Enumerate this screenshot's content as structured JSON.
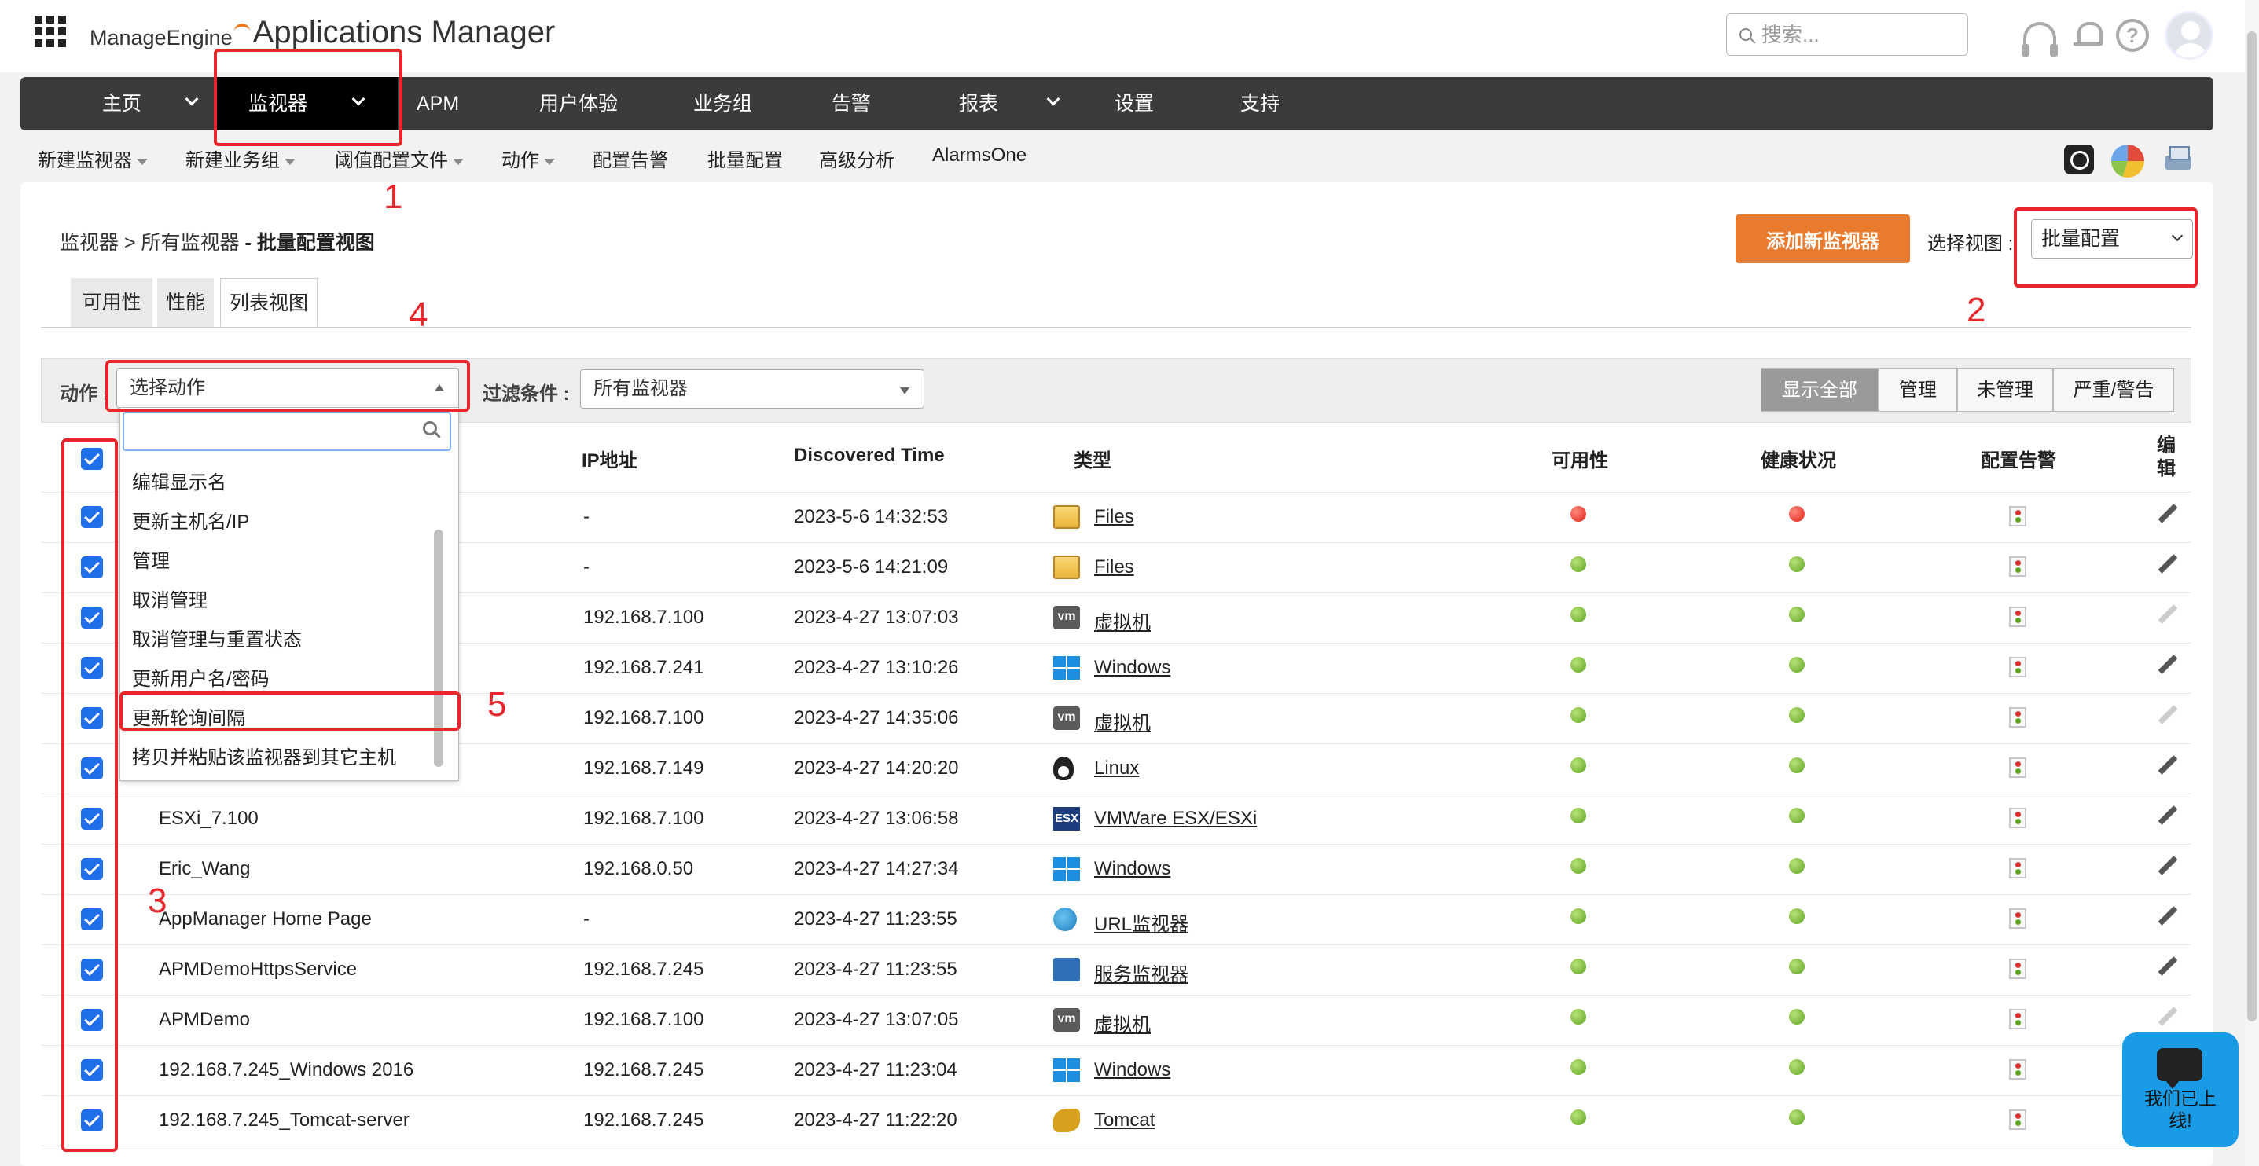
{
  "brand": {
    "prefix": "ManageEngine",
    "product": "Applications Manager"
  },
  "search": {
    "placeholder": "搜索..."
  },
  "main_nav": [
    {
      "label": "主页"
    },
    {
      "label": "监视器"
    },
    {
      "label": "APM"
    },
    {
      "label": "用户体验"
    },
    {
      "label": "业务组"
    },
    {
      "label": "告警"
    },
    {
      "label": "报表"
    },
    {
      "label": "设置"
    },
    {
      "label": "支持"
    }
  ],
  "sub_nav": [
    {
      "label": "新建监视器"
    },
    {
      "label": "新建业务组"
    },
    {
      "label": "阈值配置文件"
    },
    {
      "label": "动作"
    },
    {
      "label": "配置告警"
    },
    {
      "label": "批量配置"
    },
    {
      "label": "高级分析"
    },
    {
      "label": "AlarmsOne"
    }
  ],
  "breadcrumb": {
    "root": "监视器",
    "sep": " > ",
    "middle": "所有监视器",
    "current": " - 批量配置视图"
  },
  "add_monitor_button": "添加新监视器",
  "view": {
    "label": "选择视图 :",
    "selected": "批量配置"
  },
  "tabs": [
    {
      "label": "可用性"
    },
    {
      "label": "性能"
    },
    {
      "label": "列表视图"
    }
  ],
  "action_bar": {
    "action_label": "动作 :",
    "action_selected": "选择动作",
    "filter_label": "过滤条件 :",
    "filter_selected": "所有监视器",
    "segments": [
      {
        "label": "显示全部"
      },
      {
        "label": "管理"
      },
      {
        "label": "未管理"
      },
      {
        "label": "严重/警告"
      }
    ]
  },
  "action_dropdown": {
    "items": [
      "编辑显示名",
      "更新主机名/IP",
      "管理",
      "取消管理",
      "取消管理与重置状态",
      "更新用户名/密码",
      "更新轮询间隔",
      "拷贝并粘贴该监视器到其它主机"
    ]
  },
  "table": {
    "headers": {
      "ip": "IP地址",
      "discovered": "Discovered Time",
      "type": "类型",
      "availability": "可用性",
      "health": "健康状况",
      "alarm_config": "配置告警",
      "edit": "编\n辑"
    },
    "rows": [
      {
        "name": "",
        "ip": "-",
        "time": "2023-5-6 14:32:53",
        "type": "Files",
        "type_icon": "files-icon",
        "availability": "red",
        "health": "red",
        "editable": true
      },
      {
        "name": "",
        "ip": "-",
        "time": "2023-5-6 14:21:09",
        "type": "Files",
        "type_icon": "files-icon",
        "availability": "green",
        "health": "green",
        "editable": true
      },
      {
        "name": "",
        "ip": "192.168.7.100",
        "time": "2023-4-27 13:07:03",
        "type": "虚拟机",
        "type_icon": "vm-icon",
        "availability": "green",
        "health": "green",
        "editable": false
      },
      {
        "name": "",
        "ip": "192.168.7.241",
        "time": "2023-4-27 13:10:26",
        "type": "Windows",
        "type_icon": "windows-icon",
        "availability": "green",
        "health": "green",
        "editable": true
      },
      {
        "name": "",
        "ip": "192.168.7.100",
        "time": "2023-4-27 14:35:06",
        "type": "虚拟机",
        "type_icon": "vm-icon",
        "availability": "green",
        "health": "green",
        "editable": false
      },
      {
        "name": "",
        "ip": "192.168.7.149",
        "time": "2023-4-27 14:20:20",
        "type": "Linux",
        "type_icon": "linux-icon",
        "availability": "green",
        "health": "green",
        "editable": true
      },
      {
        "name": "ESXi_7.100",
        "ip": "192.168.7.100",
        "time": "2023-4-27 13:06:58",
        "type": "VMWare ESX/ESXi",
        "type_icon": "esx-icon",
        "availability": "green",
        "health": "green",
        "editable": true
      },
      {
        "name": "Eric_Wang",
        "ip": "192.168.0.50",
        "time": "2023-4-27 14:27:34",
        "type": "Windows",
        "type_icon": "windows-icon",
        "availability": "green",
        "health": "green",
        "editable": true
      },
      {
        "name": "AppManager Home Page",
        "ip": "-",
        "time": "2023-4-27 11:23:55",
        "type": "URL监视器",
        "type_icon": "url-icon",
        "availability": "green",
        "health": "green",
        "editable": true
      },
      {
        "name": "APMDemoHttpsService",
        "ip": "192.168.7.245",
        "time": "2023-4-27 11:23:55",
        "type": "服务监视器",
        "type_icon": "service-icon",
        "availability": "green",
        "health": "green",
        "editable": true
      },
      {
        "name": "APMDemo",
        "ip": "192.168.7.100",
        "time": "2023-4-27 13:07:05",
        "type": "虚拟机",
        "type_icon": "vm-icon",
        "availability": "green",
        "health": "green",
        "editable": false
      },
      {
        "name": "192.168.7.245_Windows 2016",
        "ip": "192.168.7.245",
        "time": "2023-4-27 11:23:04",
        "type": "Windows",
        "type_icon": "windows-icon",
        "availability": "green",
        "health": "green",
        "editable": true
      },
      {
        "name": "192.168.7.245_Tomcat-server",
        "ip": "192.168.7.245",
        "time": "2023-4-27 11:22:20",
        "type": "Tomcat",
        "type_icon": "tomcat-icon",
        "availability": "green",
        "health": "green",
        "editable": true
      }
    ]
  },
  "annotations": [
    "1",
    "2",
    "3",
    "4",
    "5"
  ],
  "chat": {
    "label": "我们已上线!"
  },
  "colors": {
    "accent_orange": "#e87b2e",
    "annotation_red": "#e8262c",
    "nav_dark": "#3b3b3b",
    "checkbox_blue": "#1f6feb"
  }
}
